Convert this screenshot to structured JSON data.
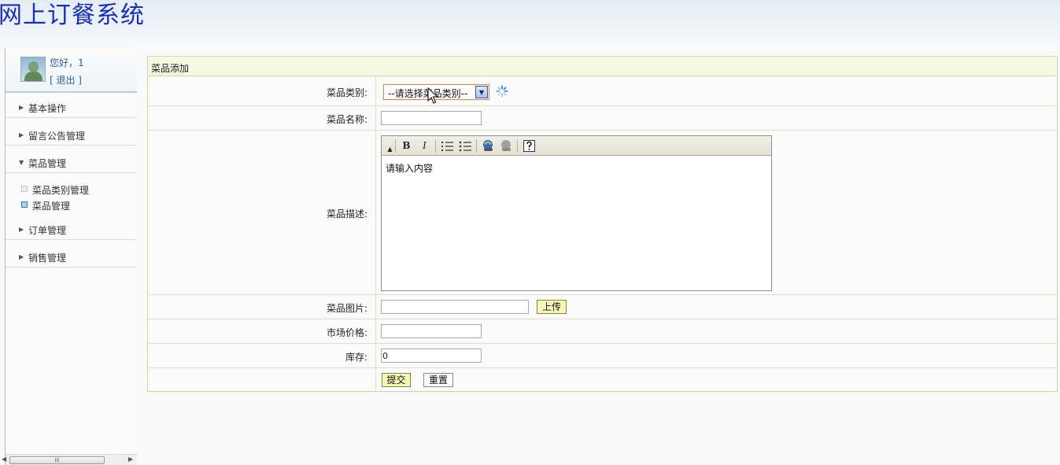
{
  "header": {
    "title": "网上订餐系统"
  },
  "sidebar": {
    "greeting": "您好，1",
    "logout": "[ 退出 ]",
    "groups": [
      {
        "label": "基本操作",
        "expanded": false
      },
      {
        "label": "留言公告管理",
        "expanded": false
      },
      {
        "label": "菜品管理",
        "expanded": true
      },
      {
        "label": "订单管理",
        "expanded": false
      },
      {
        "label": "销售管理",
        "expanded": false
      }
    ],
    "sub_items": [
      {
        "label": "菜品类别管理",
        "active": false
      },
      {
        "label": "菜品管理",
        "active": true
      }
    ],
    "scrollbar_grip": "III"
  },
  "form": {
    "title": "菜品添加",
    "category_label": "菜品类别:",
    "category_selected": "--请选择菜品类别--",
    "name_label": "菜品名称:",
    "name_value": "",
    "desc_label": "菜品描述:",
    "editor_content": "请输入内容",
    "editor_tools": [
      "B",
      "I"
    ],
    "image_label": "菜品图片:",
    "image_value": "",
    "upload_label": "上传",
    "price_label": "市场价格:",
    "price_value": "",
    "stock_label": "库存:",
    "stock_value": "0",
    "submit_label": "提交",
    "reset_label": "重置"
  },
  "colors": {
    "title": "#1a2fb4",
    "panel_border": "#cbd9a6",
    "panel_header": "#f4f9e0",
    "button_yellow": "#f6f7b8",
    "select_border": "#e0863a",
    "link": "#2e5f9e"
  }
}
